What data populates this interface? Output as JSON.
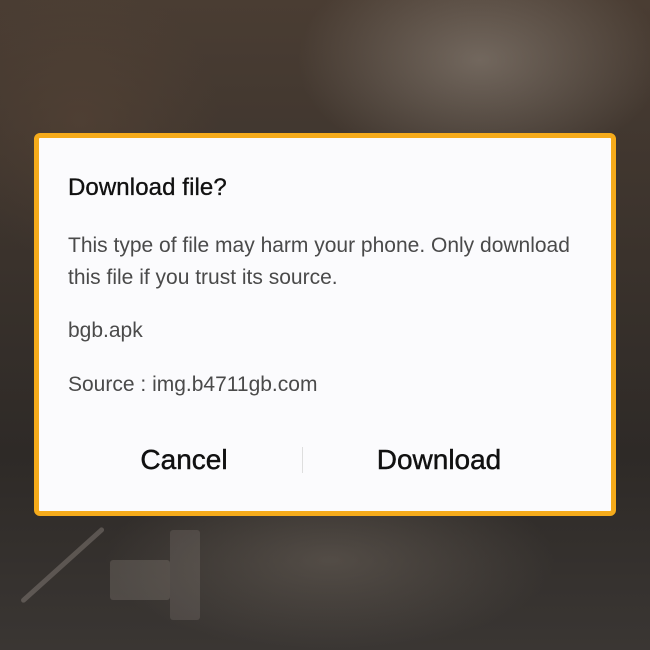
{
  "dialog": {
    "title": "Download file?",
    "message": "This type of file may harm your phone. Only download this file if you trust its source.",
    "file_name": "bgb.apk",
    "source_label": "Source",
    "source_separator": " : ",
    "source_value": "img.b4711gb.com",
    "cancel_label": "Cancel",
    "download_label": "Download"
  },
  "colors": {
    "frame_highlight": "#f5ab1b",
    "dialog_background": "#fbfbfd"
  }
}
